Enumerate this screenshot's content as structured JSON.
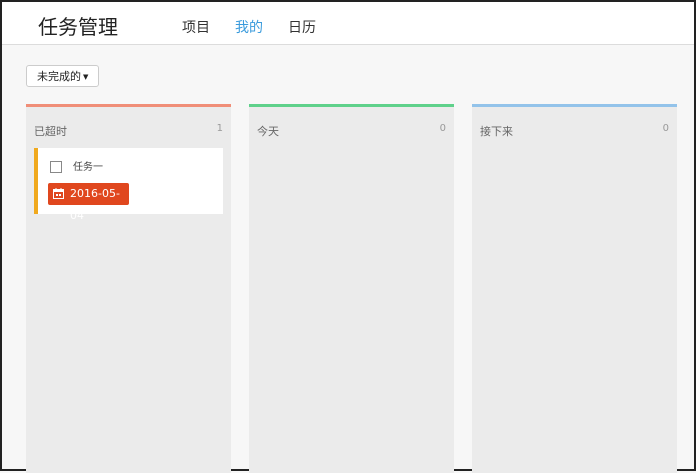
{
  "header": {
    "title": "任务管理",
    "nav": [
      "项目",
      "我的",
      "日历"
    ],
    "active_nav": 1
  },
  "filter": {
    "label": "未完成的",
    "caret": "▼"
  },
  "columns": [
    {
      "title": "已超时",
      "count": "1",
      "accent": "#f08e78",
      "tasks": [
        {
          "name": "任务一",
          "due": "2016-05-04",
          "checked": false
        }
      ]
    },
    {
      "title": "今天",
      "count": "0",
      "accent": "#5fd18b",
      "tasks": []
    },
    {
      "title": "接下来",
      "count": "0",
      "accent": "#93c3ea",
      "tasks": []
    }
  ],
  "colors": {
    "active_nav": "#3a9bdc",
    "card_stripe": "#f0a91e",
    "due_badge": "#e0471e"
  },
  "icons": {
    "date_icon": "calendar-icon",
    "caret_icon": "caret-down-icon"
  }
}
